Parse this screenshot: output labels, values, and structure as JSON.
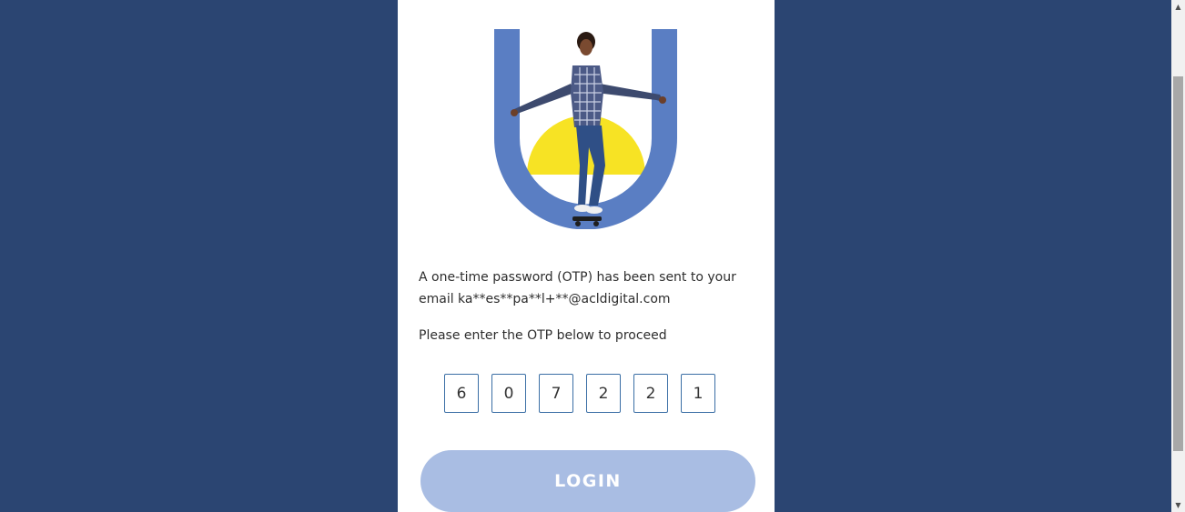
{
  "message": {
    "line1": "A one-time password (OTP) has been sent to your",
    "line2": "email ka**es**pa**l+**@acldigital.com",
    "prompt": "Please enter the OTP below to proceed"
  },
  "otp": {
    "digits": [
      "6",
      "0",
      "7",
      "2",
      "2",
      "1"
    ]
  },
  "login_button": {
    "label": "LOGIN"
  },
  "colors": {
    "page_background": "#2b4572",
    "card_background": "#ffffff",
    "u_shape": "#5a7ec3",
    "sun": "#f7e324",
    "otp_border": "#3a6ea5",
    "login_button": "#a9bde3"
  },
  "icons": {
    "scroll_up": "scroll-up-arrow-icon",
    "scroll_down": "scroll-down-arrow-icon"
  }
}
